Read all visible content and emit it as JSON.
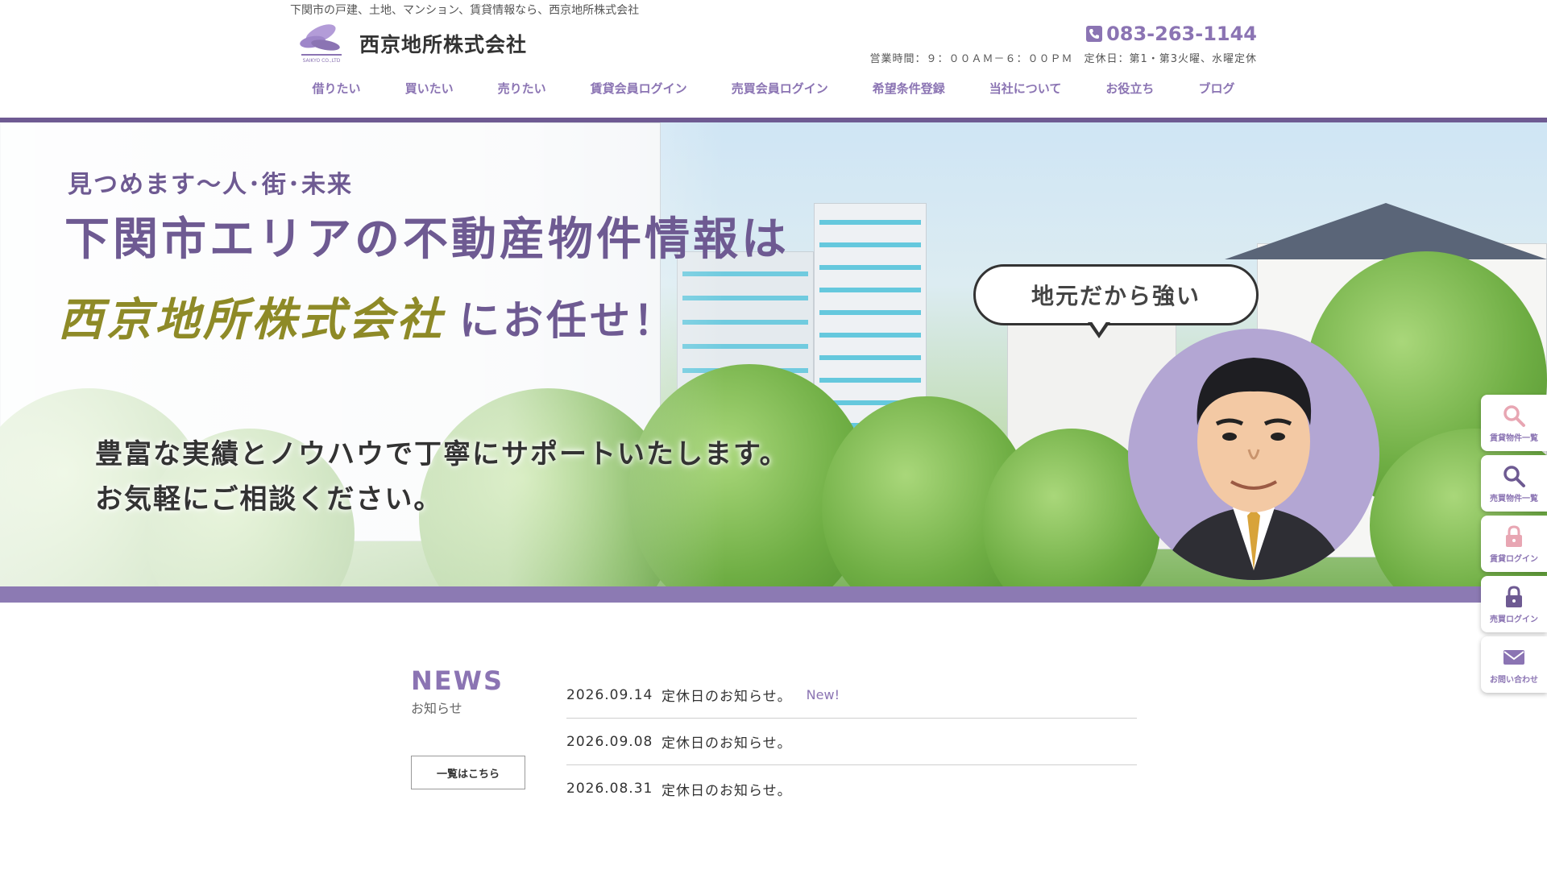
{
  "header": {
    "tagline": "下関市の戸建、土地、マンション、賃貸情報なら、西京地所株式会社",
    "company_name": "西京地所株式会社",
    "logo_text": "SAIKYO CO.,LTD",
    "phone": "083-263-1144",
    "hours": "営業時間：９：００ＡＭ－６：００ＰＭ　定休日：第1・第3火曜、水曜定休"
  },
  "nav": {
    "items": [
      {
        "label": "借りたい"
      },
      {
        "label": "買いたい"
      },
      {
        "label": "売りたい"
      },
      {
        "label": "賃貸会員ログイン"
      },
      {
        "label": "売買会員ログイン"
      },
      {
        "label": "希望条件登録"
      },
      {
        "label": "当社について"
      },
      {
        "label": "お役立ち"
      },
      {
        "label": "ブログ"
      }
    ]
  },
  "hero": {
    "slogan_small": "見つめます〜人･街･未来",
    "slogan_main": "下関市エリアの不動産物件情報は",
    "slogan_company": "西京地所株式会社",
    "slogan_tail": "にお任せ！",
    "support_line1": "豊富な実績とノウハウで丁寧にサポートいたします。",
    "support_line2": "お気軽にご相談ください。",
    "bubble": "地元だから強い"
  },
  "side_buttons": [
    {
      "label": "賃貸物件一覧",
      "icon": "search-icon"
    },
    {
      "label": "売買物件一覧",
      "icon": "search-icon"
    },
    {
      "label": "賃貸ログイン",
      "icon": "lock-icon"
    },
    {
      "label": "売買ログイン",
      "icon": "lock-icon"
    },
    {
      "label": "お問い合わせ",
      "icon": "mail-icon"
    }
  ],
  "news": {
    "title": "NEWS",
    "subtitle": "お知らせ",
    "more_label": "一覧はこちら",
    "items": [
      {
        "date": "2026.09.14",
        "text": "定休日のお知らせ。",
        "badge": "New!"
      },
      {
        "date": "2026.09.08",
        "text": "定休日のお知らせ。",
        "badge": ""
      },
      {
        "date": "2026.08.31",
        "text": "定休日のお知らせ。",
        "badge": ""
      }
    ]
  },
  "colors": {
    "accent": "#8b74b3",
    "accent_dark": "#6e5a92",
    "gold": "#8e8a27",
    "portrait_bg": "#b3a6d3",
    "side_lock_light": "#e8a6b3"
  }
}
